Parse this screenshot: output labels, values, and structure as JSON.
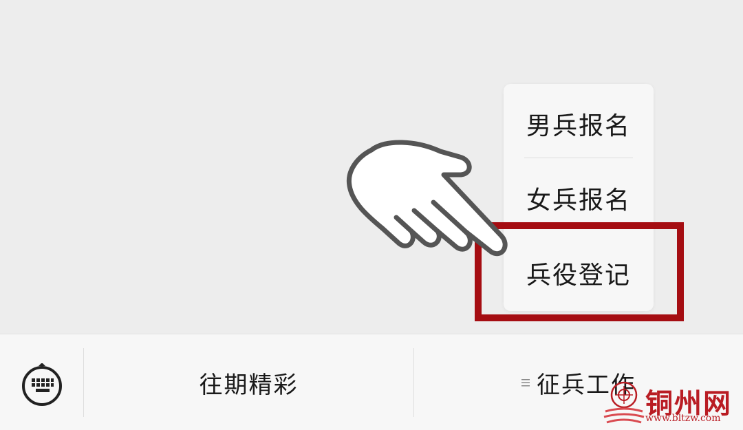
{
  "submenu": {
    "items": [
      {
        "label": "男兵报名"
      },
      {
        "label": "女兵报名"
      },
      {
        "label": "兵役登记"
      }
    ]
  },
  "menubar": {
    "toggle_icon": "keyboard-icon",
    "buttons": [
      {
        "label": "往期精彩"
      },
      {
        "label": "征兵工作",
        "icon": "list-icon"
      }
    ]
  },
  "watermark": {
    "name": "铜州网",
    "url": "www.bltzw.com"
  },
  "colors": {
    "background": "#ededed",
    "highlight": "#a50d12",
    "watermark": "#b91c23"
  }
}
